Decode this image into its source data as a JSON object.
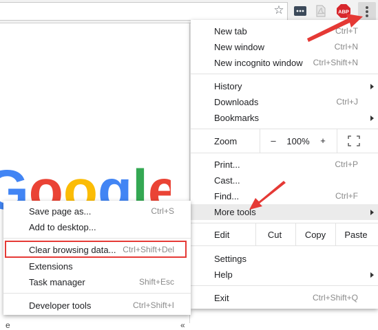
{
  "toolbar": {
    "bookmark_icon": "star-icon",
    "extensions": [
      "extension-dots-icon",
      "pdf-icon",
      "adblock-plus-icon"
    ],
    "abp_label": "ABP",
    "menu_icon": "kebab-menu-icon"
  },
  "page": {
    "logo_letters": [
      "G",
      "o",
      "o",
      "g",
      "l",
      "e"
    ],
    "logo_colors": [
      "#4285f4",
      "#ea4335",
      "#fbbc05",
      "#4285f4",
      "#34a853",
      "#ea4335"
    ],
    "partial_left": "e",
    "partial_right": "«"
  },
  "menu": {
    "new_tab": {
      "label": "New tab",
      "shortcut": "Ctrl+T"
    },
    "new_window": {
      "label": "New window",
      "shortcut": "Ctrl+N"
    },
    "new_incognito": {
      "label": "New incognito window",
      "shortcut": "Ctrl+Shift+N"
    },
    "history": {
      "label": "History"
    },
    "downloads": {
      "label": "Downloads",
      "shortcut": "Ctrl+J"
    },
    "bookmarks": {
      "label": "Bookmarks"
    },
    "zoom": {
      "label": "Zoom",
      "minus": "–",
      "level": "100%",
      "plus": "+"
    },
    "print": {
      "label": "Print...",
      "shortcut": "Ctrl+P"
    },
    "cast": {
      "label": "Cast..."
    },
    "find": {
      "label": "Find...",
      "shortcut": "Ctrl+F"
    },
    "more_tools": {
      "label": "More tools"
    },
    "edit": {
      "label": "Edit",
      "cut": "Cut",
      "copy": "Copy",
      "paste": "Paste"
    },
    "settings": {
      "label": "Settings"
    },
    "help": {
      "label": "Help"
    },
    "exit": {
      "label": "Exit",
      "shortcut": "Ctrl+Shift+Q"
    }
  },
  "submenu": {
    "save_page": {
      "label": "Save page as...",
      "shortcut": "Ctrl+S"
    },
    "add_desktop": {
      "label": "Add to desktop..."
    },
    "clear_data": {
      "label": "Clear browsing data...",
      "shortcut": "Ctrl+Shift+Del"
    },
    "extensions": {
      "label": "Extensions"
    },
    "task_manager": {
      "label": "Task manager",
      "shortcut": "Shift+Esc"
    },
    "dev_tools": {
      "label": "Developer tools",
      "shortcut": "Ctrl+Shift+I"
    }
  },
  "colors": {
    "annotation_red": "#e53935",
    "menu_highlight": "#ebebeb"
  }
}
